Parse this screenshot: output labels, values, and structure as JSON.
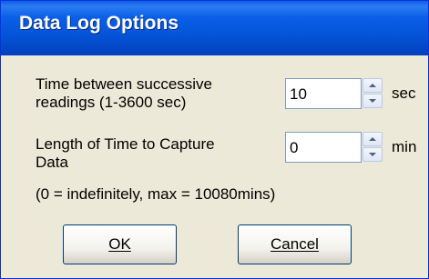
{
  "window": {
    "title": "Data Log Options"
  },
  "interval": {
    "label_line1": "Time between successive",
    "label_line2": "readings (1-3600 sec)",
    "value": "10",
    "unit": "sec"
  },
  "duration": {
    "label_line1": "Length of Time to Capture",
    "label_line2": "Data",
    "value": "0",
    "unit": "min"
  },
  "note": "(0 = indefinitely, max = 10080mins)",
  "buttons": {
    "ok_label": "OK",
    "cancel_label": "Cancel"
  },
  "colors": {
    "title_bar": "#0a5fe8",
    "dialog_background": "#ece9d8"
  },
  "icons": {
    "spin_up": "triangle-up-icon",
    "spin_down": "triangle-down-icon"
  }
}
